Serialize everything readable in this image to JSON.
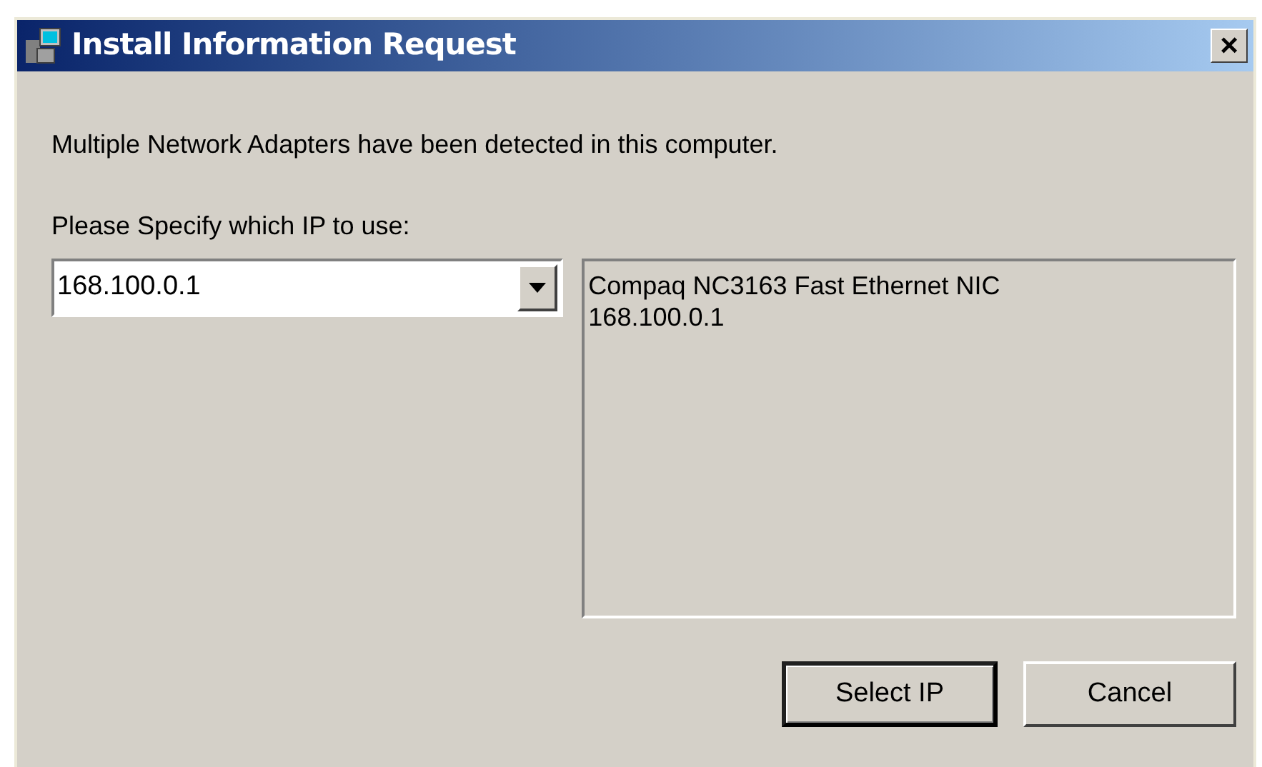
{
  "window": {
    "title": "Install Information Request",
    "close": "×"
  },
  "message": "Multiple Network Adapters have been detected in this computer.",
  "ip_prompt": "Please Specify which IP to use:",
  "ip_select": {
    "value": "168.100.0.1"
  },
  "adapter_info": [
    "Compaq NC3163 Fast Ethernet NIC",
    "168.100.0.1"
  ],
  "buttons": [
    {
      "label": "Select IP",
      "default": true
    },
    {
      "label": "Cancel",
      "default": false
    }
  ]
}
